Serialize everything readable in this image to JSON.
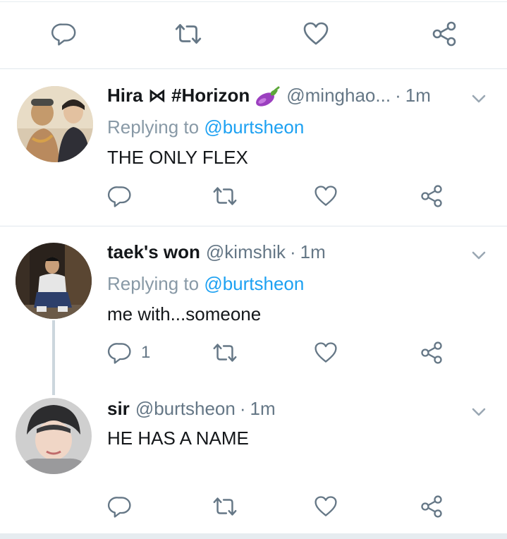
{
  "colors": {
    "name": "#14171a",
    "muted": "#657786",
    "link": "#1da1f2",
    "divider": "#e1e8ed",
    "thread": "#ccd6dd"
  },
  "action_icons": [
    "reply-icon",
    "retweet-icon",
    "like-icon",
    "share-icon"
  ],
  "tweets": [
    {
      "name": "Hira ⋈ #Horizon",
      "emoji": "eggplant",
      "handle": "@minghao...",
      "separator": "·",
      "time": "1m",
      "reply_prefix": "Replying to",
      "reply_to": "@burtsheon",
      "text": "THE ONLY FLEX",
      "reply_count": ""
    },
    {
      "name": "taek's won",
      "handle": "@kimshik",
      "separator": "·",
      "time": "1m",
      "reply_prefix": "Replying to",
      "reply_to": "@burtsheon",
      "text": "me with...someone",
      "reply_count": "1"
    },
    {
      "name": "sir",
      "handle": "@burtsheon",
      "separator": "·",
      "time": "1m",
      "text": "HE HAS A NAME",
      "reply_count": ""
    }
  ]
}
